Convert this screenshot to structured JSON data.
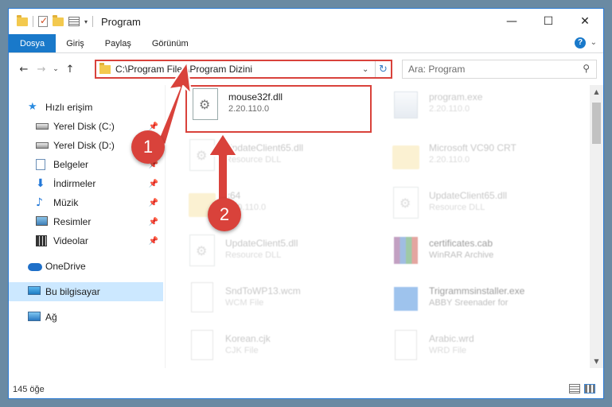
{
  "window": {
    "title": "Program",
    "buttons": {
      "minimize": "—",
      "maximize": "☐",
      "close": "✕"
    },
    "quick_access_arrow": "▾"
  },
  "ribbon": {
    "tabs": [
      "Dosya",
      "Giriş",
      "Paylaş",
      "Görünüm"
    ],
    "expand": "⌄",
    "help": "?"
  },
  "nav": {
    "back": "←",
    "forward": "→",
    "recent": "⌄",
    "up": "↑",
    "address": "C:\\Program Files\\Program Dizini",
    "address_dropdown": "⌄",
    "refresh": "↻",
    "search_placeholder": "Ara: Program",
    "search_icon": "⚲"
  },
  "sidebar": {
    "pin_glyph": "📌",
    "items": [
      {
        "label": "Hızlı erişim",
        "icon": "star-icon",
        "pinned": false
      },
      {
        "label": "Yerel Disk (C:)",
        "icon": "disk-icon",
        "pinned": true
      },
      {
        "label": "Yerel Disk (D:)",
        "icon": "disk-icon",
        "pinned": true
      },
      {
        "label": "Belgeler",
        "icon": "document-icon",
        "pinned": true
      },
      {
        "label": "İndirmeler",
        "icon": "download-icon",
        "pinned": true
      },
      {
        "label": "Müzik",
        "icon": "music-icon",
        "pinned": true
      },
      {
        "label": "Resimler",
        "icon": "pictures-icon",
        "pinned": true
      },
      {
        "label": "Videolar",
        "icon": "video-icon",
        "pinned": true
      },
      {
        "label": "OneDrive",
        "icon": "cloud-icon",
        "pinned": false
      },
      {
        "label": "Bu bilgisayar",
        "icon": "computer-icon",
        "pinned": false,
        "selected": true
      },
      {
        "label": "Ağ",
        "icon": "network-icon",
        "pinned": false
      }
    ]
  },
  "files": [
    {
      "name": "mouse32f.dll",
      "desc": "2.20.110.0",
      "icon": "dll-file-icon",
      "highlighted": true
    },
    {
      "name": "program.exe",
      "desc": "2.20.110.0",
      "icon": "exe-file-icon"
    },
    {
      "name": "UpdateClient65.dll",
      "desc": "Resource DLL",
      "icon": "dll-file-icon"
    },
    {
      "name": "Microsoft VC90 CRT",
      "desc": "2.20.110.0",
      "icon": "folder-icon"
    },
    {
      "name": "x64",
      "desc": "2.20.110.0",
      "icon": "folder-icon"
    },
    {
      "name": "UpdateClient65.dll",
      "desc": "Resource DLL",
      "icon": "dll-file-icon"
    },
    {
      "name": "UpdateClient5.dll",
      "desc": "Resource DLL",
      "icon": "dll-file-icon"
    },
    {
      "name": "certificates.cab",
      "desc": "WinRAR Archive",
      "icon": "archive-icon"
    },
    {
      "name": "SndToWP13.wcm",
      "desc": "WCM File",
      "icon": "file-icon"
    },
    {
      "name": "Trigrammsinstaller.exe",
      "desc": "ABBY Sreenader for",
      "icon": "installer-icon"
    },
    {
      "name": "Korean.cjk",
      "desc": "CJK File",
      "icon": "file-icon"
    },
    {
      "name": "Arabic.wrd",
      "desc": "WRD File",
      "icon": "file-icon"
    }
  ],
  "scrollbar": {
    "up": "▲",
    "down": "▼"
  },
  "status": {
    "count": "145 öğe"
  },
  "annotations": {
    "step1": "1",
    "step2": "2",
    "color": "#d9423b"
  }
}
